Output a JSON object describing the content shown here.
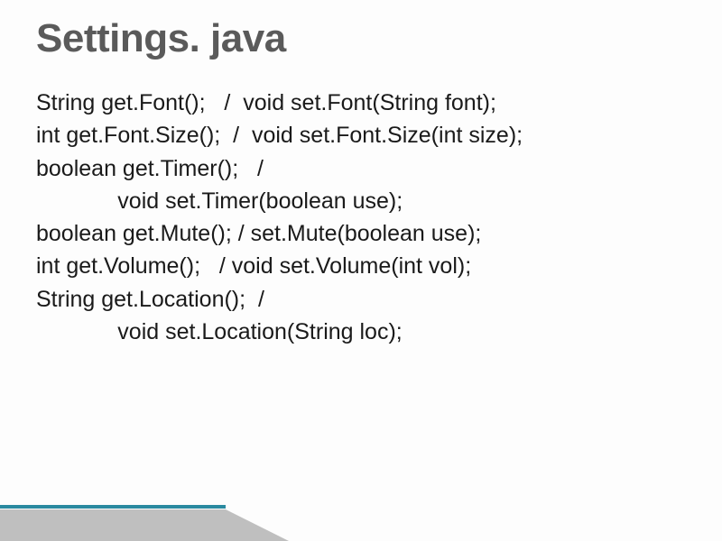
{
  "title": "Settings. java",
  "lines": [
    "String get.Font();   /  void set.Font(String font);",
    "int get.Font.Size();  /  void set.Font.Size(int size);",
    "boolean get.Timer();   /",
    "             void set.Timer(boolean use);",
    "boolean get.Mute(); / set.Mute(boolean use);",
    "int get.Volume();   / void set.Volume(int vol);",
    "String get.Location();  /",
    "             void set.Location(String loc);"
  ],
  "decoration": {
    "line_color": "#2a8aa0",
    "shadow_color": "#bfbfbf"
  }
}
